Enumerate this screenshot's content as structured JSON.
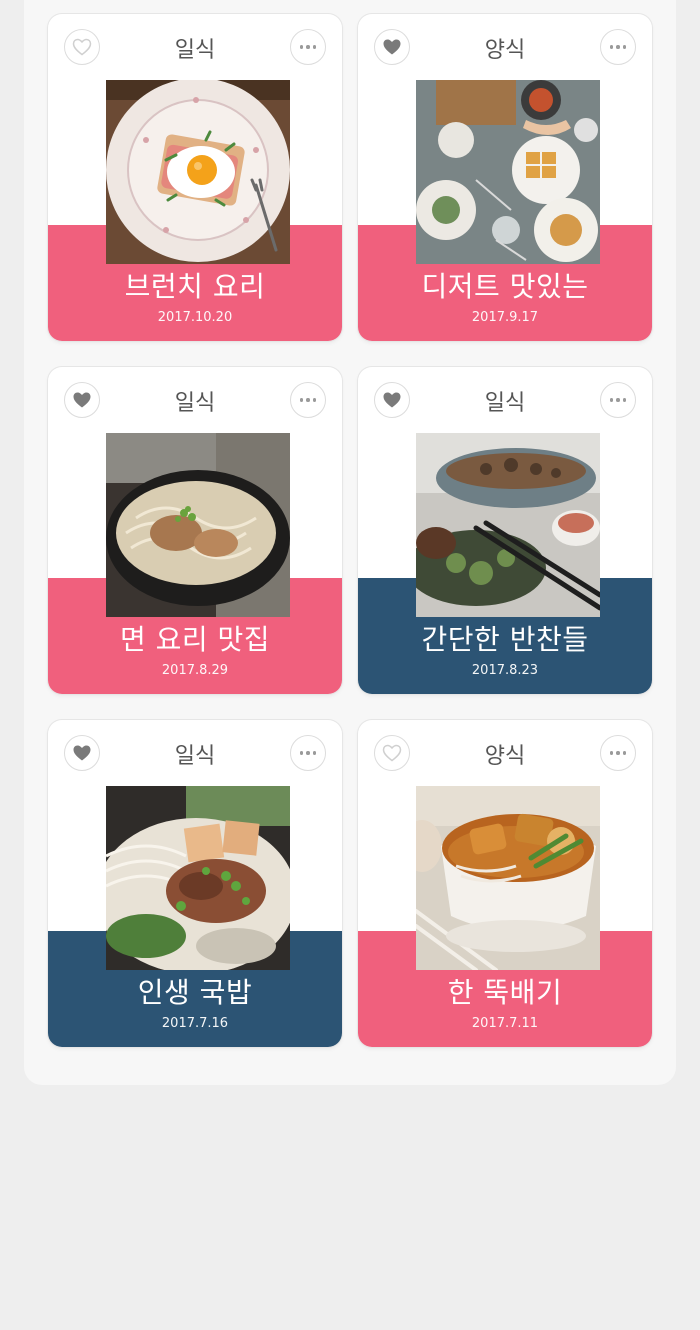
{
  "colors": {
    "pink": "#f0607d",
    "navy": "#2c5474",
    "heart_filled": "#7a7a7a",
    "heart_outline": "#d8d8d8"
  },
  "cards": [
    {
      "category": "일식",
      "title": "브런치 요리",
      "date": "2017.10.20",
      "band": "pink",
      "liked": false,
      "photo": "eggs-toast-plate"
    },
    {
      "category": "양식",
      "title": "디저트 맛있는",
      "date": "2017.9.17",
      "band": "pink",
      "liked": true,
      "photo": "waffle-table"
    },
    {
      "category": "일식",
      "title": "면 요리 맛집",
      "date": "2017.8.29",
      "band": "pink",
      "liked": true,
      "photo": "noodle-bowl"
    },
    {
      "category": "일식",
      "title": "간단한 반찬들",
      "date": "2017.8.23",
      "band": "navy",
      "liked": true,
      "photo": "side-dishes-chopsticks"
    },
    {
      "category": "일식",
      "title": "인생 국밥",
      "date": "2017.7.16",
      "band": "navy",
      "liked": true,
      "photo": "beef-noodle-soup"
    },
    {
      "category": "양식",
      "title": "한 뚝배기",
      "date": "2017.7.11",
      "band": "pink",
      "liked": false,
      "photo": "curry-noodle-bowl"
    }
  ]
}
